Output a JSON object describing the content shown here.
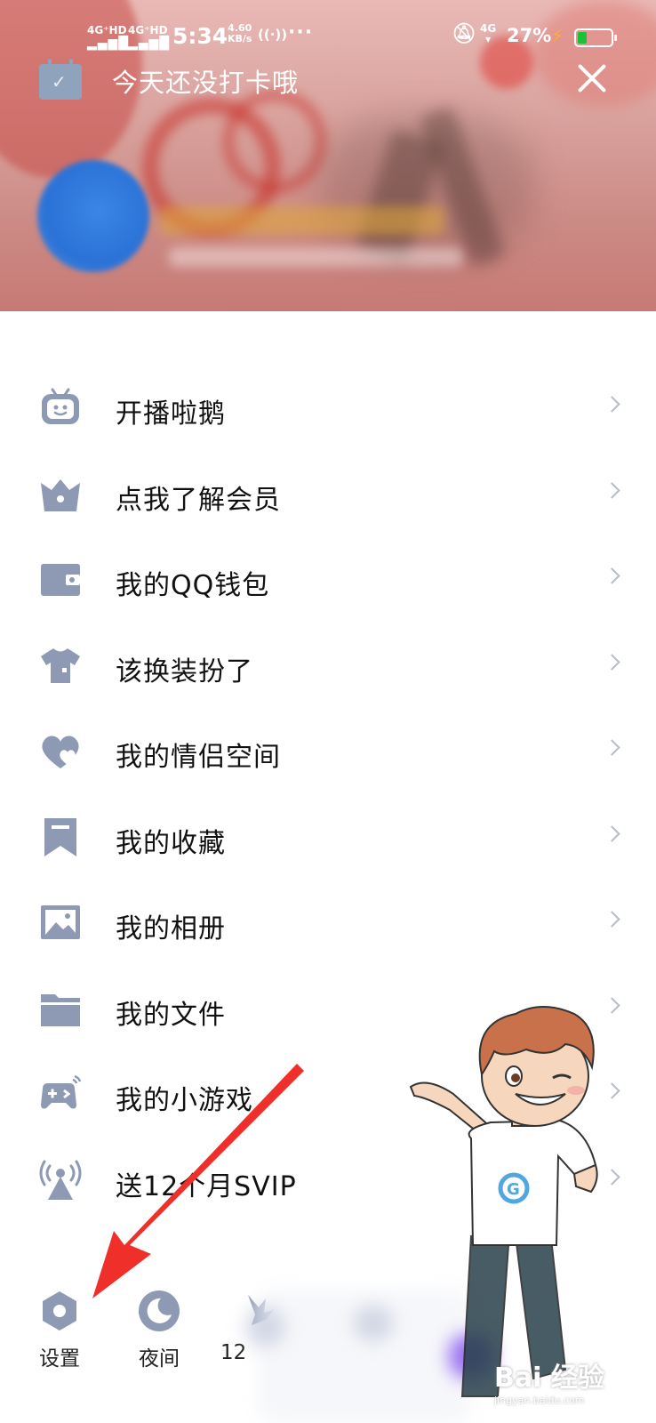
{
  "status_bar": {
    "signal1_label": "4G⁺HD",
    "signal2_label": "4G⁺HD",
    "time": "5:34",
    "speed_value": "4.60",
    "speed_unit": "KB/s",
    "hotspot_glyph": "((·))",
    "more_glyph": "···",
    "network": "4G",
    "battery_percent": "27%",
    "battery_level": 0.27,
    "accent_battery_color": "#19c236",
    "charging_color": "#ffb01f"
  },
  "header": {
    "checkin_text": "今天还没打卡哦",
    "checkin_icon": "calendar-check-icon",
    "close_icon": "close-icon",
    "avatar": "avatar"
  },
  "menu": {
    "items": [
      {
        "label": "开播啦鹅",
        "icon": "tv-robot-icon"
      },
      {
        "label": "点我了解会员",
        "icon": "crown-icon"
      },
      {
        "label": "我的QQ钱包",
        "icon": "wallet-icon"
      },
      {
        "label": "该换装扮了",
        "icon": "shirt-icon"
      },
      {
        "label": "我的情侣空间",
        "icon": "hearts-icon"
      },
      {
        "label": "我的收藏",
        "icon": "bookmark-icon"
      },
      {
        "label": "我的相册",
        "icon": "photo-icon"
      },
      {
        "label": "我的文件",
        "icon": "folder-icon"
      },
      {
        "label": "我的小游戏",
        "icon": "gamepad-icon"
      },
      {
        "label": "送12个月SVIP",
        "icon": "broadcast-icon"
      }
    ],
    "icon_color": "#8e99b3"
  },
  "bottom_bar": {
    "settings_label": "设置",
    "night_label": "夜间",
    "third_label": "12"
  },
  "watermark": {
    "text": "Bai 经验",
    "sub": "jingyan.baidu.com"
  }
}
